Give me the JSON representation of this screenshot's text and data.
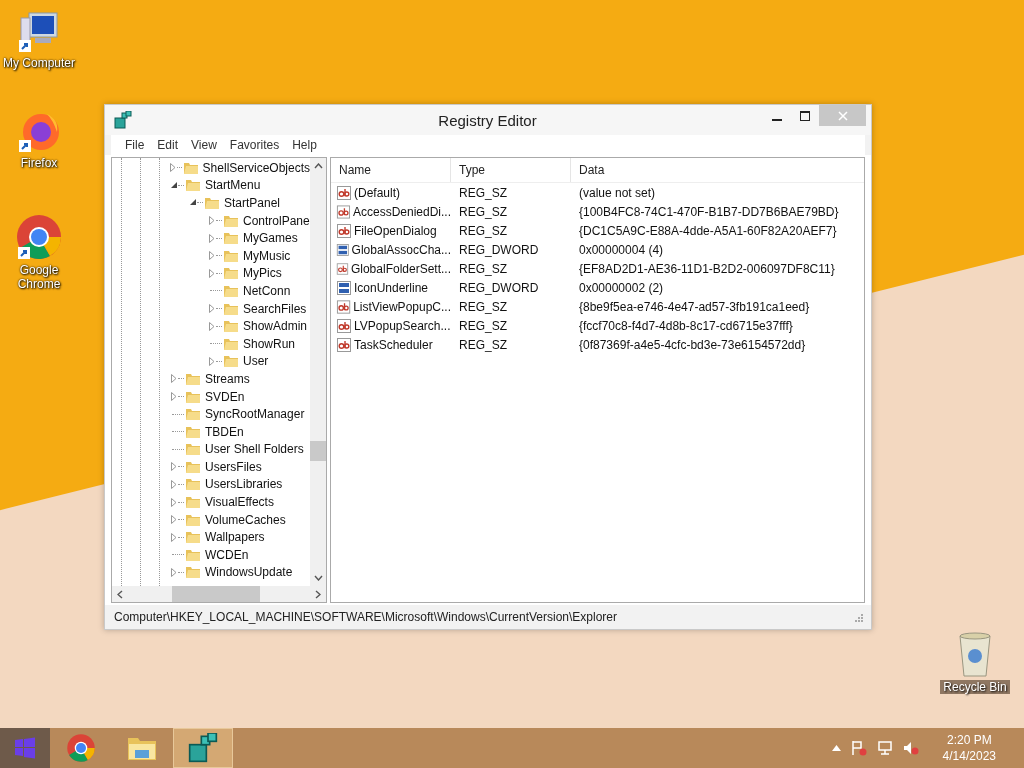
{
  "desktop_icons": [
    {
      "label": "My Computer",
      "kind": "computer"
    },
    {
      "label": "Firefox",
      "kind": "firefox"
    },
    {
      "label": "Google Chrome",
      "kind": "chrome"
    },
    {
      "label": "Recycle Bin",
      "kind": "recycle"
    }
  ],
  "window": {
    "title": "Registry Editor",
    "menu": [
      "File",
      "Edit",
      "View",
      "Favorites",
      "Help"
    ],
    "tree": [
      {
        "label": "ShellServiceObjects",
        "kind": "branch",
        "expanded": false
      },
      {
        "label": "StartMenu",
        "kind": "branch",
        "expanded": true,
        "children": [
          {
            "label": "StartPanel",
            "kind": "branch",
            "expanded": true,
            "children": [
              {
                "label": "ControlPane",
                "kind": "branch",
                "expanded": false
              },
              {
                "label": "MyGames",
                "kind": "branch",
                "expanded": false
              },
              {
                "label": "MyMusic",
                "kind": "branch",
                "expanded": false
              },
              {
                "label": "MyPics",
                "kind": "branch",
                "expanded": false
              },
              {
                "label": "NetConn",
                "kind": "leaf",
                "expanded": false
              },
              {
                "label": "SearchFiles",
                "kind": "branch",
                "expanded": false
              },
              {
                "label": "ShowAdmin",
                "kind": "branch",
                "expanded": false
              },
              {
                "label": "ShowRun",
                "kind": "leaf",
                "expanded": false
              },
              {
                "label": "User",
                "kind": "branch",
                "expanded": false
              }
            ]
          }
        ]
      },
      {
        "label": "Streams",
        "kind": "branch",
        "expanded": false
      },
      {
        "label": "SVDEn",
        "kind": "branch",
        "expanded": false
      },
      {
        "label": "SyncRootManager",
        "kind": "leaf",
        "expanded": false
      },
      {
        "label": "TBDEn",
        "kind": "leaf",
        "expanded": false
      },
      {
        "label": "User Shell Folders",
        "kind": "leaf",
        "expanded": false
      },
      {
        "label": "UsersFiles",
        "kind": "branch",
        "expanded": false
      },
      {
        "label": "UsersLibraries",
        "kind": "branch",
        "expanded": false
      },
      {
        "label": "VisualEffects",
        "kind": "branch",
        "expanded": false
      },
      {
        "label": "VolumeCaches",
        "kind": "branch",
        "expanded": false
      },
      {
        "label": "Wallpapers",
        "kind": "branch",
        "expanded": false
      },
      {
        "label": "WCDEn",
        "kind": "leaf",
        "expanded": false
      },
      {
        "label": "WindowsUpdate",
        "kind": "branch",
        "expanded": false
      }
    ],
    "table": {
      "columns": [
        "Name",
        "Type",
        "Data"
      ],
      "rows": [
        {
          "name": "(Default)",
          "type": "REG_SZ",
          "data": "(value not set)",
          "kind": "string"
        },
        {
          "name": "AccessDeniedDi...",
          "type": "REG_SZ",
          "data": "{100B4FC8-74C1-470F-B1B7-DD7B6BAE79BD}",
          "kind": "string"
        },
        {
          "name": "FileOpenDialog",
          "type": "REG_SZ",
          "data": "{DC1C5A9C-E88A-4dde-A5A1-60F82A20AEF7}",
          "kind": "string"
        },
        {
          "name": "GlobalAssocCha...",
          "type": "REG_DWORD",
          "data": "0x00000004 (4)",
          "kind": "binary"
        },
        {
          "name": "GlobalFolderSett...",
          "type": "REG_SZ",
          "data": "{EF8AD2D1-AE36-11D1-B2D2-006097DF8C11}",
          "kind": "string"
        },
        {
          "name": "IconUnderline",
          "type": "REG_DWORD",
          "data": "0x00000002 (2)",
          "kind": "binary"
        },
        {
          "name": "ListViewPopupC...",
          "type": "REG_SZ",
          "data": "{8be9f5ea-e746-4e47-ad57-3fb191ca1eed}",
          "kind": "string"
        },
        {
          "name": "LVPopupSearch...",
          "type": "REG_SZ",
          "data": "{fccf70c8-f4d7-4d8b-8c17-cd6715e37fff}",
          "kind": "string"
        },
        {
          "name": "TaskScheduler",
          "type": "REG_SZ",
          "data": "{0f87369f-a4e5-4cfc-bd3e-73e6154572dd}",
          "kind": "string"
        }
      ]
    },
    "status_bar": "Computer\\HKEY_LOCAL_MACHINE\\SOFTWARE\\Microsoft\\Windows\\CurrentVersion\\Explorer"
  },
  "taskbar": {
    "apps": [
      {
        "kind": "start",
        "selected": false
      },
      {
        "kind": "chrome",
        "selected": false
      },
      {
        "kind": "explorer",
        "selected": false
      },
      {
        "kind": "regedit",
        "selected": true
      }
    ],
    "time": "2:20 PM",
    "date": "4/14/2023"
  }
}
